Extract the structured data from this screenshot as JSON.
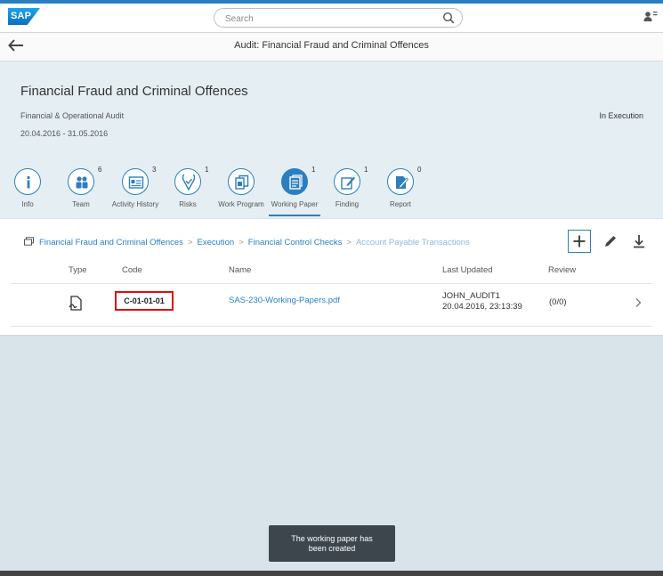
{
  "shell": {
    "logo": "SAP",
    "search_placeholder": "Search"
  },
  "title_bar": {
    "title": "Audit: Financial Fraud and Criminal Offences"
  },
  "header": {
    "title": "Financial Fraud and Criminal Offences",
    "subtitle": "Financial & Operational Audit",
    "dates": "20.04.2016 - 31.05.2016",
    "status": "In Execution"
  },
  "tabs": [
    {
      "label": "Info",
      "count": "",
      "icon": "info-icon"
    },
    {
      "label": "Team",
      "count": "6",
      "icon": "group-icon"
    },
    {
      "label": "Activity History",
      "count": "3",
      "icon": "history-icon"
    },
    {
      "label": "Risks",
      "count": "1",
      "icon": "risk-icon"
    },
    {
      "label": "Work Program",
      "count": "",
      "icon": "documents-icon"
    },
    {
      "label": "Working Paper",
      "count": "1",
      "icon": "working-paper-icon",
      "selected": true
    },
    {
      "label": "Finding",
      "count": "1",
      "icon": "finding-icon"
    },
    {
      "label": "Report",
      "count": "0",
      "icon": "report-icon"
    }
  ],
  "breadcrumb": {
    "items": [
      "Financial Fraud and Criminal Offences",
      "Execution",
      "Financial Control Checks"
    ],
    "current": "Account Payable Transactions"
  },
  "table": {
    "columns": [
      "Type",
      "Code",
      "Name",
      "Last Updated",
      "Review"
    ],
    "rows": [
      {
        "type_icon": "attachment-document-icon",
        "code": "C-01-01-01",
        "name": "SAS-230-Working-Papers.pdf",
        "updated_by": "JOHN_AUDIT1",
        "updated_at": "20.04.2016, 23:13:39",
        "review": "(0/0)"
      }
    ]
  },
  "toast": {
    "line1": "The working paper has",
    "line2": "been created"
  },
  "colors": {
    "accent": "#2b7fc1",
    "highlight": "#dd1111"
  }
}
